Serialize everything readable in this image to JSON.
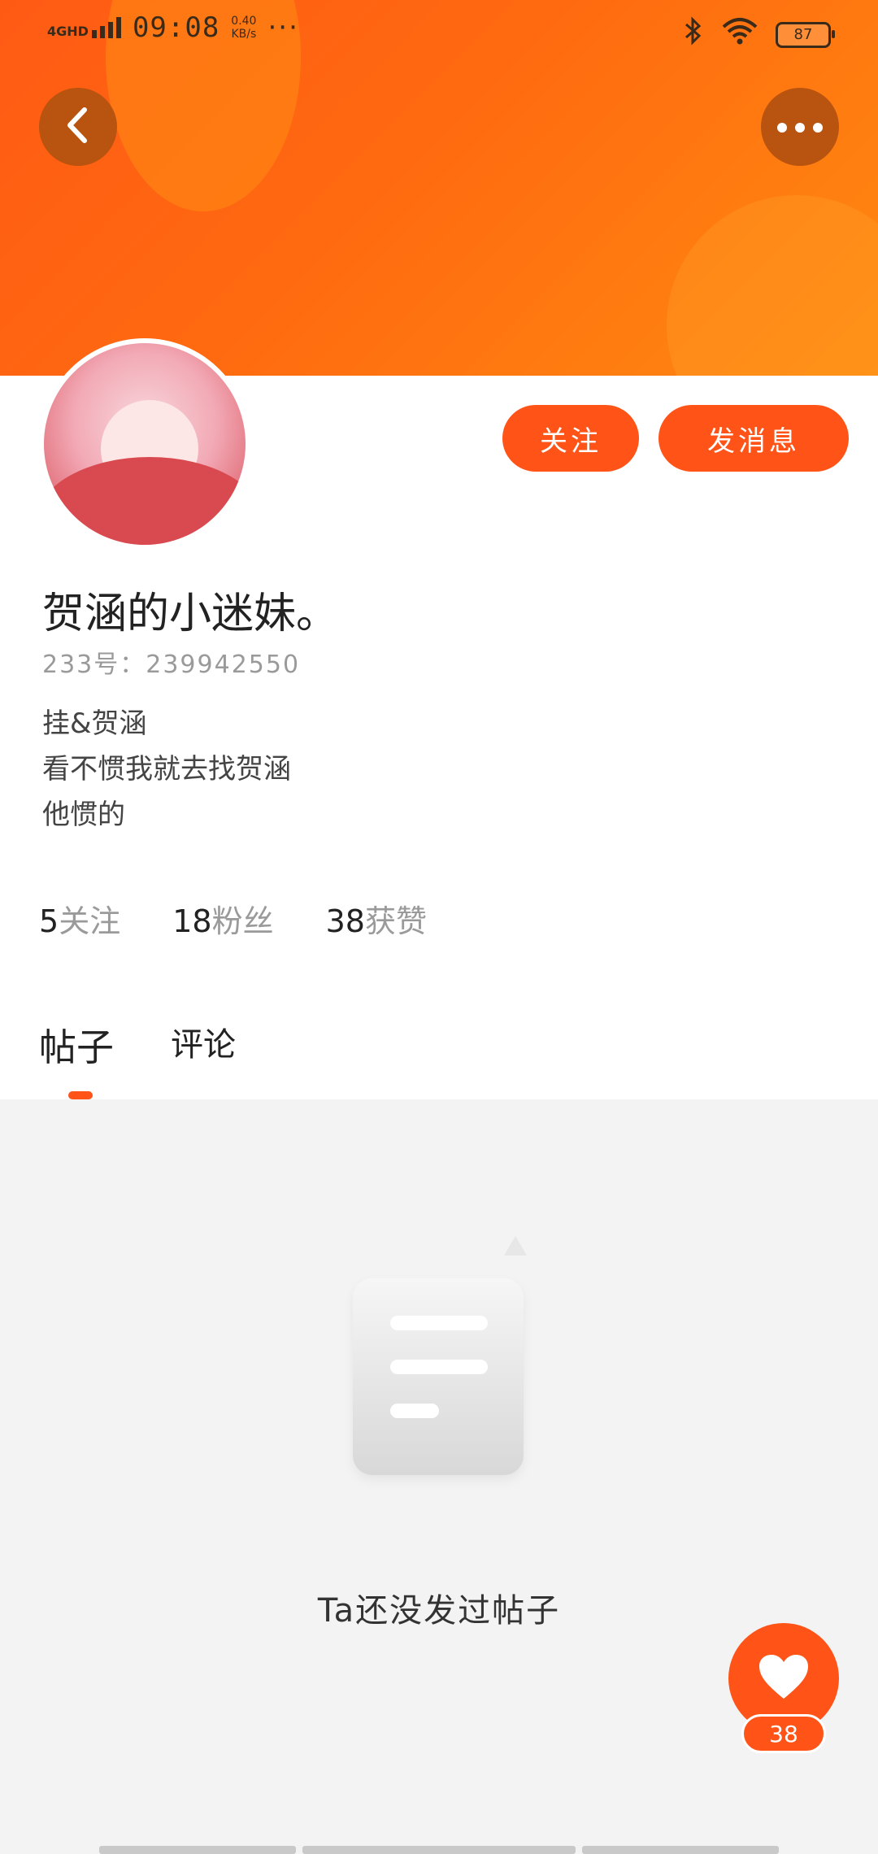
{
  "status_bar": {
    "network": "4GHD",
    "time": "09:08",
    "speed_value": "0.40",
    "speed_unit": "KB/s",
    "battery": "87"
  },
  "header": {
    "back_icon": "chevron-left-icon",
    "more_icon": "more-horizontal-icon"
  },
  "profile": {
    "follow_label": "关注",
    "message_label": "发消息",
    "name": "贺涵的小迷妹。",
    "uid": "233号：239942550",
    "bio": [
      "挂&贺涵",
      "看不惯我就去找贺涵",
      "他惯的"
    ],
    "stats": [
      {
        "value": "5",
        "label": "关注"
      },
      {
        "value": "18",
        "label": "粉丝"
      },
      {
        "value": "38",
        "label": "获赞"
      }
    ]
  },
  "tabs": [
    {
      "label": "帖子",
      "active": true
    },
    {
      "label": "评论",
      "active": false
    }
  ],
  "empty_state": {
    "text": "Ta还没发过帖子"
  },
  "like": {
    "count": "38"
  },
  "colors": {
    "accent": "#ff5317",
    "banner_start": "#ff5a14",
    "banner_end": "#ff8a10"
  }
}
